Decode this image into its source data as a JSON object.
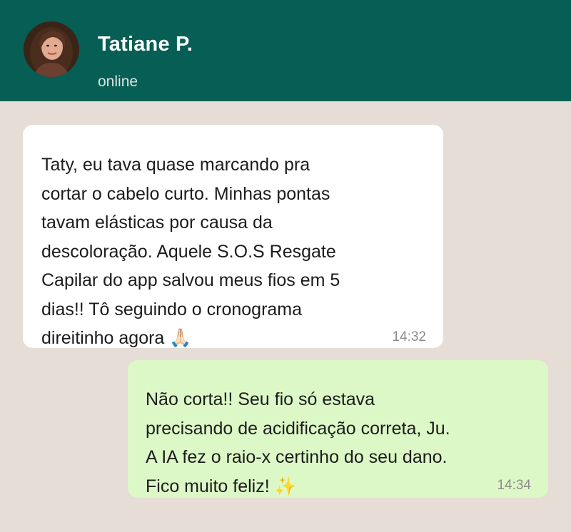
{
  "header": {
    "contact_name": "Tatiane P.",
    "status": "online",
    "avatar_icon": "profile-photo"
  },
  "messages": [
    {
      "direction": "incoming",
      "text": "Taty, eu tava quase marcando pra\ncortar o cabelo curto. Minhas pontas\ntavam elásticas por causa da\ndescoloração. Aquele S.O.S Resgate\nCapilar do app salvou meus fios em 5\ndias!! Tô seguindo o cronograma\ndireitinho agora",
      "emoji": "🙏🏻",
      "time": "14:32"
    },
    {
      "direction": "outgoing",
      "text": "Não corta!! Seu fio só estava\nprecisando de acidificação correta, Ju.\nA IA fez o raio-x certinho do seu dano.\nFico muito feliz!",
      "emoji": "✨",
      "time": "14:34"
    }
  ],
  "colors": {
    "header": "#075e54",
    "background": "#e6ddd7",
    "incoming_bubble": "#ffffff",
    "outgoing_bubble": "#dcf8c6"
  }
}
